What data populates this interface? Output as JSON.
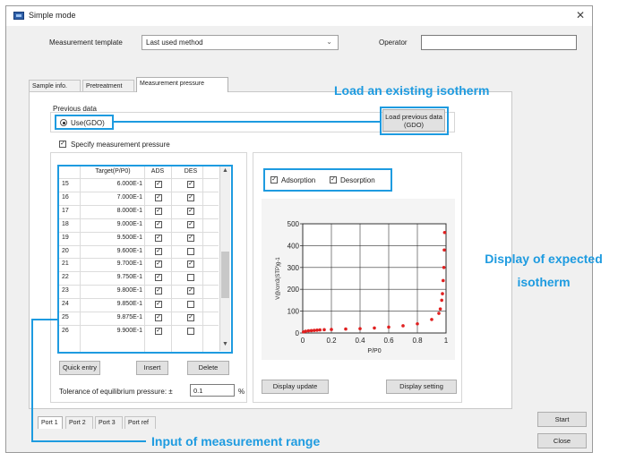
{
  "window": {
    "title": "Simple mode"
  },
  "header": {
    "template_label": "Measurement template",
    "template_value": "Last used method",
    "operator_label": "Operator",
    "operator_value": ""
  },
  "tabs": [
    {
      "label": "Sample info."
    },
    {
      "label": "Pretreatment"
    },
    {
      "label": "Measurement pressure",
      "active": true
    }
  ],
  "previous_data": {
    "group_label": "Previous data",
    "radio_label": "Use(GDO)",
    "load_button": "Load previous data (GDO)",
    "specify_label": "Specify measurement pressure",
    "specify_checked": true
  },
  "table": {
    "headers": [
      "Target(P/P0)",
      "ADS",
      "DES"
    ],
    "rows": [
      {
        "no": "15",
        "target": "6.000E-1",
        "ads": true,
        "des": true
      },
      {
        "no": "16",
        "target": "7.000E-1",
        "ads": true,
        "des": true
      },
      {
        "no": "17",
        "target": "8.000E-1",
        "ads": true,
        "des": true
      },
      {
        "no": "18",
        "target": "9.000E-1",
        "ads": true,
        "des": true
      },
      {
        "no": "19",
        "target": "9.500E-1",
        "ads": true,
        "des": true
      },
      {
        "no": "20",
        "target": "9.600E-1",
        "ads": true,
        "des": false
      },
      {
        "no": "21",
        "target": "9.700E-1",
        "ads": true,
        "des": true
      },
      {
        "no": "22",
        "target": "9.750E-1",
        "ads": true,
        "des": false
      },
      {
        "no": "23",
        "target": "9.800E-1",
        "ads": true,
        "des": true
      },
      {
        "no": "24",
        "target": "9.850E-1",
        "ads": true,
        "des": false
      },
      {
        "no": "25",
        "target": "9.875E-1",
        "ads": true,
        "des": true
      },
      {
        "no": "26",
        "target": "9.900E-1",
        "ads": true,
        "des": false
      }
    ]
  },
  "table_buttons": {
    "quick": "Quick entry",
    "insert": "Insert",
    "delete": "Delete"
  },
  "tolerance": {
    "label": "Tolerance of equilibrium pressure: ±",
    "value": "0.1",
    "unit": "%"
  },
  "display": {
    "adsorption_label": "Adsorption",
    "desorption_label": "Desorption",
    "adsorption_checked": true,
    "desorption_checked": true,
    "update_button": "Display update",
    "setting_button": "Display setting"
  },
  "ports": [
    "Port 1",
    "Port 2",
    "Port 3",
    "Port ref"
  ],
  "actions": {
    "start": "Start",
    "close": "Close"
  },
  "callouts": {
    "load": "Load an existing isotherm",
    "display": "Display of expected isotherm",
    "input": "Input of measurement range"
  },
  "colors": {
    "accent": "#1e9be0",
    "point": "#e02020"
  },
  "chart_data": {
    "type": "scatter",
    "xlabel": "P/P0",
    "ylabel": "V@/cm3(STP)g-1",
    "xlim": [
      0,
      1
    ],
    "ylim": [
      0,
      500
    ],
    "xticks": [
      "0",
      "0.2",
      "0.4",
      "0.6",
      "0.8",
      "1"
    ],
    "yticks": [
      "0",
      "100",
      "200",
      "300",
      "400",
      "500"
    ],
    "grid": true,
    "series": [
      {
        "x": [
          0.005,
          0.02,
          0.04,
          0.06,
          0.08,
          0.1,
          0.12,
          0.15,
          0.2,
          0.3,
          0.4,
          0.5,
          0.6,
          0.7,
          0.8,
          0.9,
          0.95,
          0.96,
          0.97,
          0.975,
          0.98,
          0.985,
          0.9875,
          0.99
        ],
        "y": [
          5,
          8,
          10,
          11,
          12,
          13,
          14,
          15,
          16,
          18,
          20,
          23,
          27,
          33,
          42,
          62,
          90,
          110,
          150,
          180,
          240,
          300,
          380,
          460
        ]
      }
    ]
  }
}
